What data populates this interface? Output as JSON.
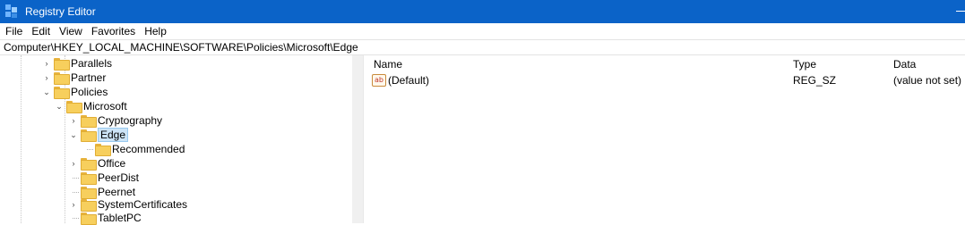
{
  "window": {
    "title": "Registry Editor"
  },
  "menu": [
    "File",
    "Edit",
    "View",
    "Favorites",
    "Help"
  ],
  "address": "Computer\\HKEY_LOCAL_MACHINE\\SOFTWARE\\Policies\\Microsoft\\Edge",
  "tree": [
    {
      "label": "Parallels",
      "chevron": "›"
    },
    {
      "label": "Partner",
      "chevron": "›"
    },
    {
      "label": "Policies",
      "chevron": "⌄"
    },
    {
      "label": "Microsoft",
      "chevron": "⌄"
    },
    {
      "label": "Cryptography",
      "chevron": "›"
    },
    {
      "label": "Edge",
      "chevron": "⌄",
      "selected": true
    },
    {
      "label": "Recommended",
      "chevron": ""
    },
    {
      "label": "Office",
      "chevron": "›"
    },
    {
      "label": "PeerDist",
      "chevron": ""
    },
    {
      "label": "Peernet",
      "chevron": ""
    },
    {
      "label": "SystemCertificates",
      "chevron": "›"
    },
    {
      "label": "TabletPC",
      "chevron": ""
    }
  ],
  "columns": {
    "name": "Name",
    "type": "Type",
    "data": "Data"
  },
  "values": [
    {
      "icon": "string-value-icon",
      "icon_text": "ab",
      "name": "(Default)",
      "type": "REG_SZ",
      "data": "(value not set)"
    }
  ],
  "colors": {
    "titlebar": "#0b63c8",
    "selection": "#cce4f7",
    "folder": "#f7cf5d"
  }
}
